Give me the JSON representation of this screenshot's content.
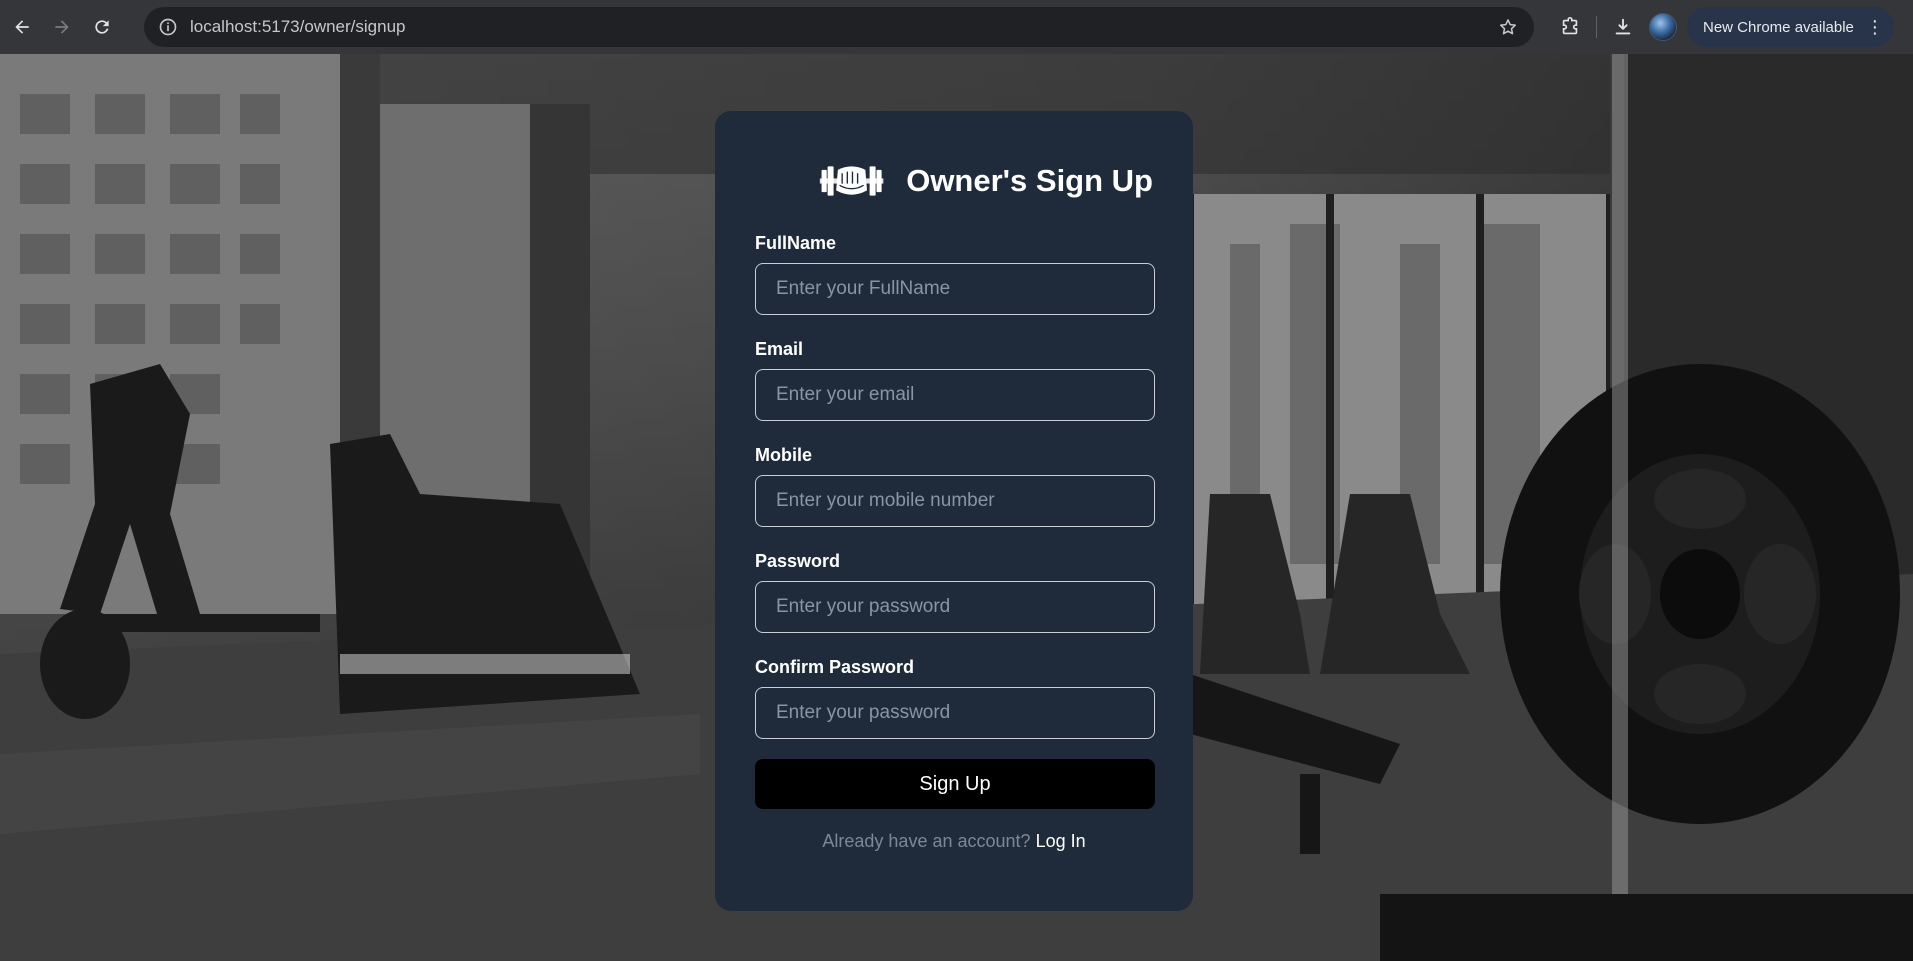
{
  "browser": {
    "url": "localhost:5173/owner/signup",
    "update_chip_label": "New Chrome available",
    "menu_glyph": "⋮"
  },
  "card": {
    "title": "Owner's Sign Up",
    "logo_icon": "gym-fist-dumbbell-logo",
    "fields": [
      {
        "label": "FullName",
        "placeholder": "Enter your FullName",
        "value": ""
      },
      {
        "label": "Email",
        "placeholder": "Enter your email",
        "value": ""
      },
      {
        "label": "Mobile",
        "placeholder": "Enter your mobile number",
        "value": ""
      },
      {
        "label": "Password",
        "placeholder": "Enter your password",
        "value": ""
      },
      {
        "label": "Confirm Password",
        "placeholder": "Enter your password",
        "value": ""
      }
    ],
    "submit_label": "Sign Up",
    "footer_prompt": "Already have an account?",
    "login_link": "Log In"
  },
  "colors": {
    "card_bg": "#1f2a3b",
    "button_bg": "#000000",
    "chrome_bg": "#35363a"
  }
}
